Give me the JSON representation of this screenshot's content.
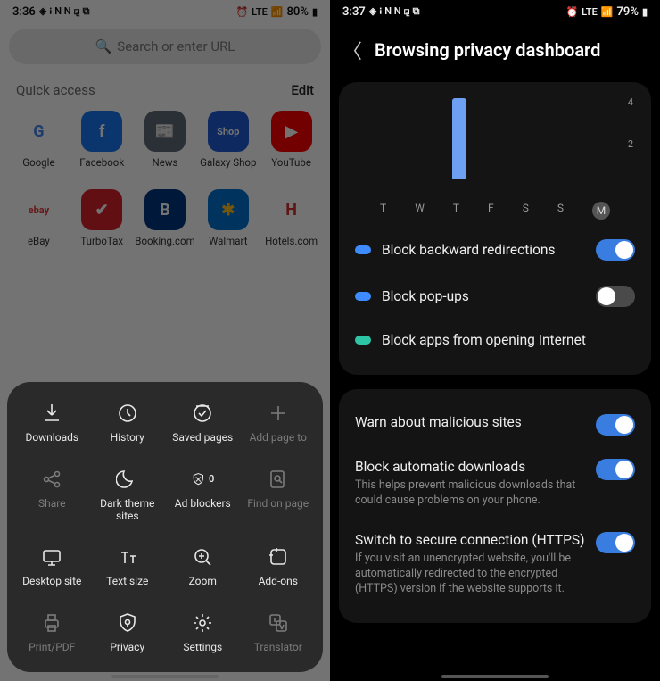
{
  "left": {
    "status": {
      "time": "3:36",
      "battery": "80%",
      "net": "LTE"
    },
    "search_placeholder": "Search or enter URL",
    "quick_access_label": "Quick access",
    "edit_label": "Edit",
    "sites": [
      {
        "name": "Google",
        "icon_text": "G",
        "bg": "#ffffff",
        "color": "#4285F4"
      },
      {
        "name": "Facebook",
        "icon_text": "f",
        "bg": "#1877f2",
        "color": "#fff"
      },
      {
        "name": "News",
        "icon_text": "📰",
        "bg": "#5f6b7a",
        "color": "#fff"
      },
      {
        "name": "Galaxy Shop",
        "icon_text": "Shop",
        "bg": "#1e5bd6",
        "color": "#fff"
      },
      {
        "name": "YouTube",
        "icon_text": "▶",
        "bg": "#ff0000",
        "color": "#fff"
      },
      {
        "name": "eBay",
        "icon_text": "ebay",
        "bg": "#ffffff",
        "color": "#e53238"
      },
      {
        "name": "TurboTax",
        "icon_text": "✔",
        "bg": "#d8232a",
        "color": "#fff"
      },
      {
        "name": "Booking.com",
        "icon_text": "B",
        "bg": "#003580",
        "color": "#fff"
      },
      {
        "name": "Walmart",
        "icon_text": "✱",
        "bg": "#0071ce",
        "color": "#ffc220"
      },
      {
        "name": "Hotels.com",
        "icon_text": "H",
        "bg": "#ffffff",
        "color": "#d32f2f"
      }
    ],
    "sheet": [
      {
        "label": "Downloads",
        "icon": "download",
        "enabled": true
      },
      {
        "label": "History",
        "icon": "history",
        "enabled": true
      },
      {
        "label": "Saved pages",
        "icon": "saved",
        "enabled": true
      },
      {
        "label": "Add page to",
        "icon": "plus",
        "enabled": false
      },
      {
        "label": "Share",
        "icon": "share",
        "enabled": false
      },
      {
        "label": "Dark theme sites",
        "icon": "moon",
        "enabled": true
      },
      {
        "label": "Ad blockers",
        "icon": "shield",
        "enabled": true,
        "badge": "0"
      },
      {
        "label": "Find on page",
        "icon": "find",
        "enabled": false
      },
      {
        "label": "Desktop site",
        "icon": "desktop",
        "enabled": true
      },
      {
        "label": "Text size",
        "icon": "textsize",
        "enabled": true
      },
      {
        "label": "Zoom",
        "icon": "zoom",
        "enabled": true
      },
      {
        "label": "Add-ons",
        "icon": "addons",
        "enabled": true
      },
      {
        "label": "Print/PDF",
        "icon": "print",
        "enabled": false
      },
      {
        "label": "Privacy",
        "icon": "privacy",
        "enabled": true
      },
      {
        "label": "Settings",
        "icon": "settings",
        "enabled": true
      },
      {
        "label": "Translator",
        "icon": "translate",
        "enabled": false
      }
    ]
  },
  "right": {
    "status": {
      "time": "3:37",
      "battery": "79%",
      "net": "LTE"
    },
    "title": "Browsing privacy dashboard",
    "blockers": [
      {
        "label": "Block backward redirections",
        "color": "#3d8bff",
        "toggle": "on"
      },
      {
        "label": "Block pop-ups",
        "color": "#3d8bff",
        "toggle": "off"
      },
      {
        "label": "Block apps from opening Internet",
        "color": "#2ec4a6",
        "toggle": null
      }
    ],
    "settings": [
      {
        "title": "Warn about malicious sites",
        "desc": "",
        "toggle": "on"
      },
      {
        "title": "Block automatic downloads",
        "desc": "This helps prevent malicious downloads that could cause problems on your phone.",
        "toggle": "on"
      },
      {
        "title": "Switch to secure connection (HTTPS)",
        "desc": "If you visit an unencrypted website, you'll be automatically redirected to the encrypted (HTTPS) version if the website supports it.",
        "toggle": "on"
      }
    ]
  },
  "chart_data": {
    "type": "bar",
    "categories": [
      "T",
      "W",
      "T",
      "F",
      "S",
      "S",
      "M"
    ],
    "values": [
      0,
      0,
      4,
      0,
      0,
      0,
      0
    ],
    "ylim": [
      0,
      4
    ],
    "yticks": [
      4,
      2
    ],
    "today_index": 6
  }
}
